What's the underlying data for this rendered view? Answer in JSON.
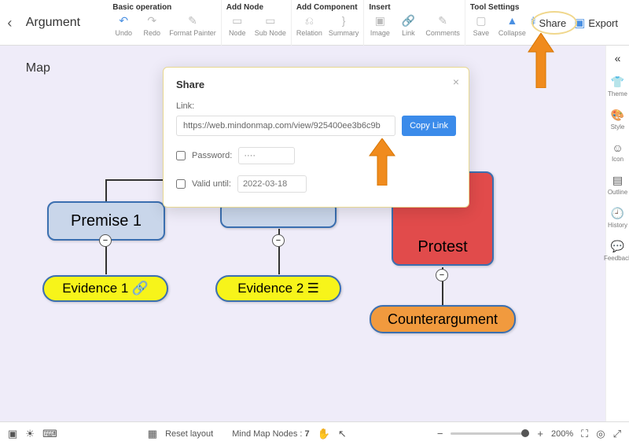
{
  "title": "Argument Map",
  "toolbar": {
    "basic": {
      "label": "Basic operation",
      "undo": "Undo",
      "redo": "Redo",
      "format": "Format Painter"
    },
    "addnode": {
      "label": "Add Node",
      "node": "Node",
      "subnode": "Sub Node"
    },
    "addcomp": {
      "label": "Add Component",
      "relation": "Relation",
      "summary": "Summary"
    },
    "insert": {
      "label": "Insert",
      "image": "Image",
      "link": "Link",
      "comments": "Comments"
    },
    "tools": {
      "label": "Tool Settings",
      "save": "Save",
      "collapse": "Collapse"
    }
  },
  "actions": {
    "share": "Share",
    "export": "Export"
  },
  "sidebar": {
    "theme": "Theme",
    "style": "Style",
    "icon": "Icon",
    "outline": "Outline",
    "history": "History",
    "feedback": "Feedback"
  },
  "nodes": {
    "premise1": "Premise 1",
    "evidence1": "Evidence 1",
    "evidence2": "Evidence 2",
    "protest": "Protest",
    "counter": "Counterargument"
  },
  "modal": {
    "title": "Share",
    "link_label": "Link:",
    "link_value": "https://web.mindonmap.com/view/925400ee3b6c9b",
    "copy": "Copy Link",
    "password_label": "Password:",
    "password_placeholder": "····",
    "valid_label": "Valid until:",
    "date_placeholder": "2022-03-18"
  },
  "footer": {
    "reset": "Reset layout",
    "nodes_label": "Mind Map Nodes :",
    "nodes_count": "7",
    "zoom": "200%"
  }
}
